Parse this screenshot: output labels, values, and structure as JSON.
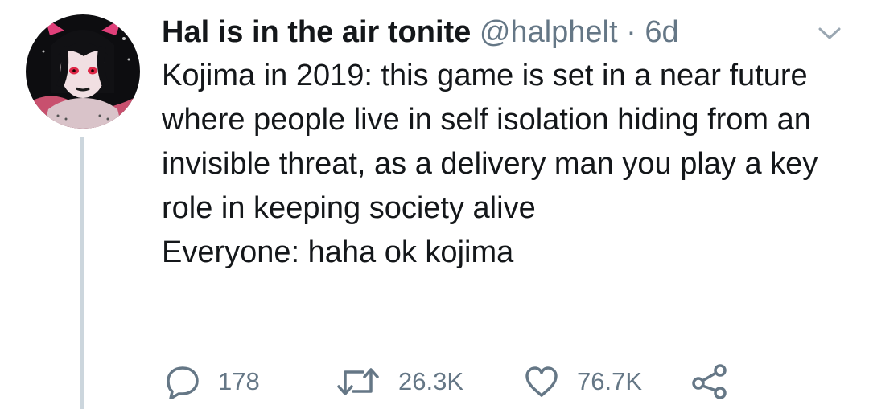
{
  "tweet": {
    "display_name": "Hal is in the air tonite",
    "handle": "@halphelt",
    "separator": "·",
    "time": "6d",
    "lines": [
      "Kojima in 2019: this game is set in a near future where people live in self isolation hiding from an invisible threat, as a delivery man you play a key role in keeping society alive",
      "Everyone: haha ok kojima"
    ]
  },
  "actions": {
    "replies": "178",
    "retweets": "26.3K",
    "likes": "76.7K"
  },
  "icons": {
    "reply": "reply-icon",
    "retweet": "retweet-icon",
    "like": "heart-icon",
    "share": "share-icon",
    "menu": "chevron-down-icon"
  },
  "colors": {
    "text": "#14171a",
    "secondary": "#657786",
    "thread_line": "#ccd6dd"
  }
}
